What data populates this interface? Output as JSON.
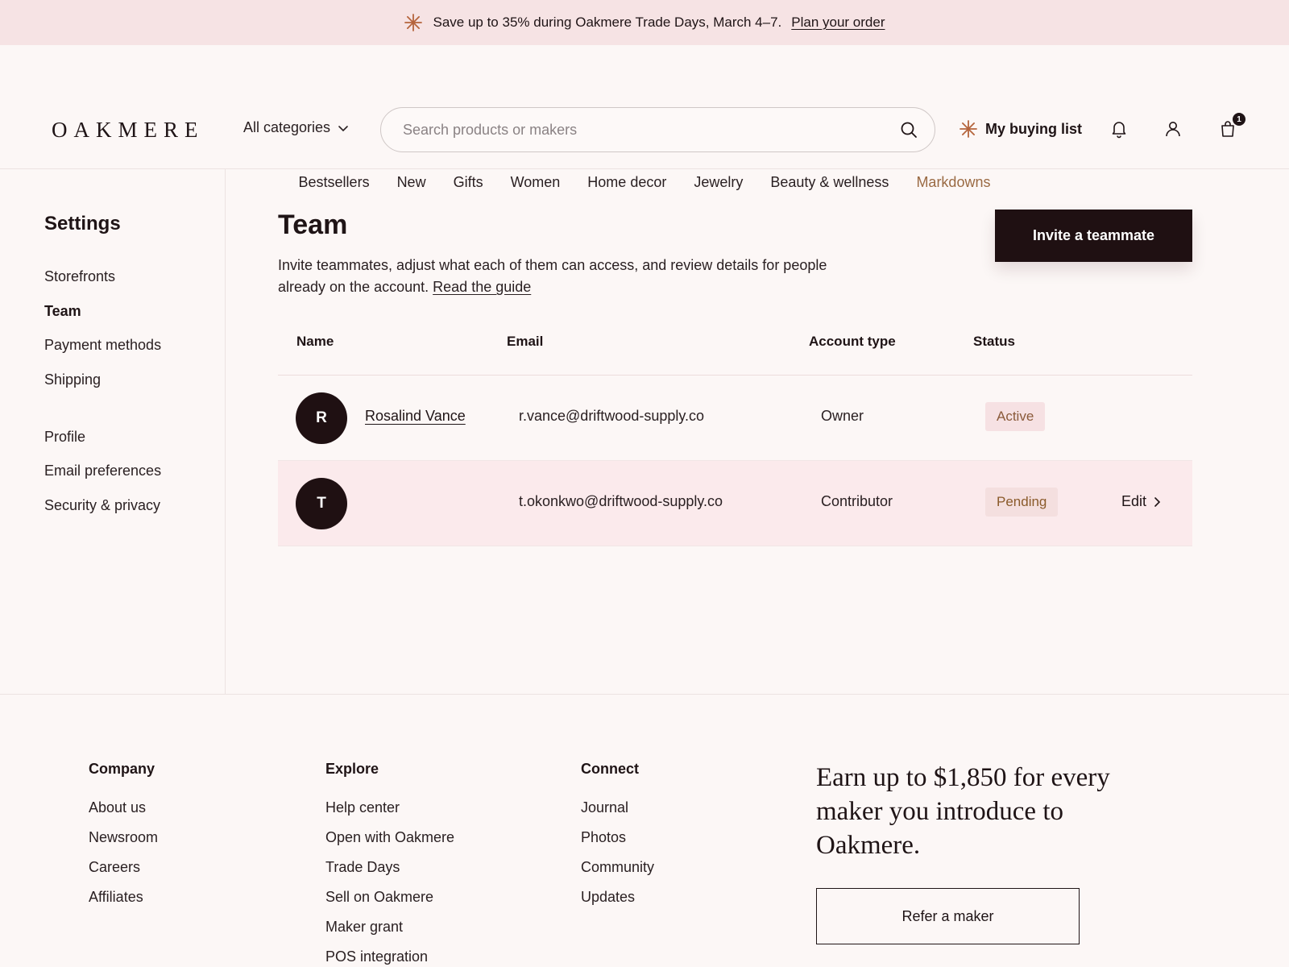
{
  "promo": {
    "text": "Save up to 35% during Oakmere Trade Days, March 4–7.",
    "link": "Plan your order"
  },
  "header": {
    "logo": "OAKMERE",
    "categories": "All categories",
    "search_placeholder": "Search products or makers",
    "buying_list": "My buying list",
    "cart_count": "1"
  },
  "nav": [
    "Bestsellers",
    "New",
    "Gifts",
    "Women",
    "Home decor",
    "Jewelry",
    "Beauty & wellness",
    "Markdowns"
  ],
  "sidebar": {
    "title": "Settings",
    "items": [
      "Storefronts",
      "Team",
      "Payment methods",
      "Shipping",
      "Profile",
      "Email preferences",
      "Security & privacy"
    ]
  },
  "main": {
    "title": "Team",
    "description": "Invite teammates, adjust what each of them can access, and review details for people already on the account.",
    "guide_link": "Read the guide",
    "invite_button": "Invite a teammate",
    "columns": [
      "Name",
      "Email",
      "Account type",
      "Status"
    ],
    "rows": [
      {
        "initial": "R",
        "name": "Rosalind Vance",
        "email": "r.vance@driftwood-supply.co",
        "type": "Owner",
        "status": "Active"
      },
      {
        "initial": "T",
        "name": "",
        "email": "t.okonkwo@driftwood-supply.co",
        "type": "Contributor",
        "status": "Pending",
        "action": "Edit"
      }
    ]
  },
  "footer": {
    "columns": [
      {
        "title": "Company",
        "links": [
          "About us",
          "Newsroom",
          "Careers",
          "Affiliates"
        ]
      },
      {
        "title": "Explore",
        "links": [
          "Help center",
          "Open with Oakmere",
          "Trade Days",
          "Sell on Oakmere",
          "Maker grant",
          "POS integration"
        ]
      },
      {
        "title": "Connect",
        "links": [
          "Journal",
          "Photos",
          "Community",
          "Updates"
        ]
      }
    ],
    "promo_text": "Earn up to $1,850 for every maker you introduce to Oakmere.",
    "refer_button": "Refer a maker"
  },
  "colors": {
    "promo_bg": "#f6e3e4",
    "accent": "#9a6a43",
    "dark": "#1f1012"
  }
}
